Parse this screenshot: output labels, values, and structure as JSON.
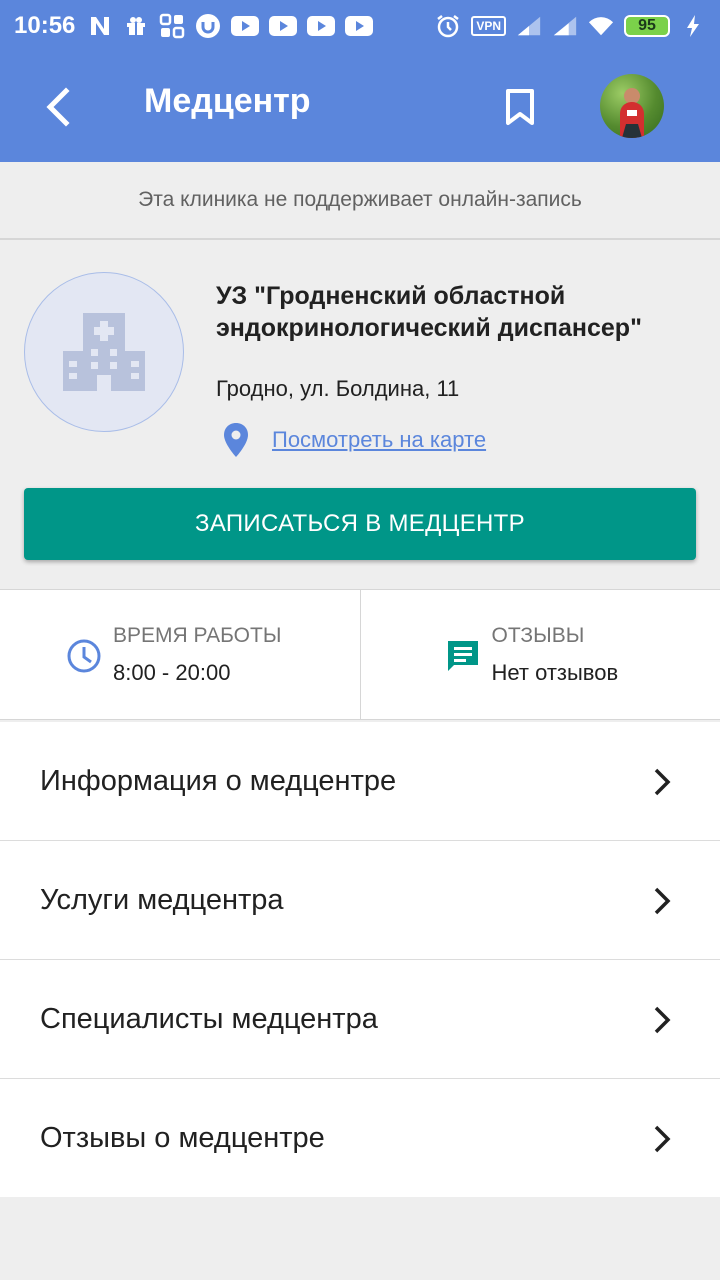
{
  "status_bar": {
    "time": "10:56",
    "vpn": "VPN",
    "battery": "95",
    "colors": {
      "background": "#5b86dc",
      "battery": "#7bd14a"
    }
  },
  "toolbar": {
    "title": "Медцентр",
    "icons": [
      "back-arrow-icon",
      "bookmark-icon",
      "avatar"
    ]
  },
  "notice": {
    "text": "Эта клиника не поддерживает онлайн-запись"
  },
  "clinic": {
    "name": "УЗ \"Гродненский областной эндокринологический диспансер\"",
    "address": "Гродно, ул. Болдина, 11",
    "map_link": "Посмотреть на карте",
    "book_button": "ЗАПИСАТЬСЯ В МЕДЦЕНТР",
    "colors": {
      "accent": "#009688",
      "link": "#5b86dc"
    }
  },
  "info": {
    "hours_label": "ВРЕМЯ РАБОТЫ",
    "hours_value": "8:00 - 20:00",
    "reviews_label": "ОТЗЫВЫ",
    "reviews_value": "Нет отзывов"
  },
  "menu": {
    "items": [
      {
        "label": "Информация о медцентре"
      },
      {
        "label": "Услуги медцентра"
      },
      {
        "label": "Специалисты медцентра"
      },
      {
        "label": "Отзывы о медцентре"
      }
    ]
  }
}
